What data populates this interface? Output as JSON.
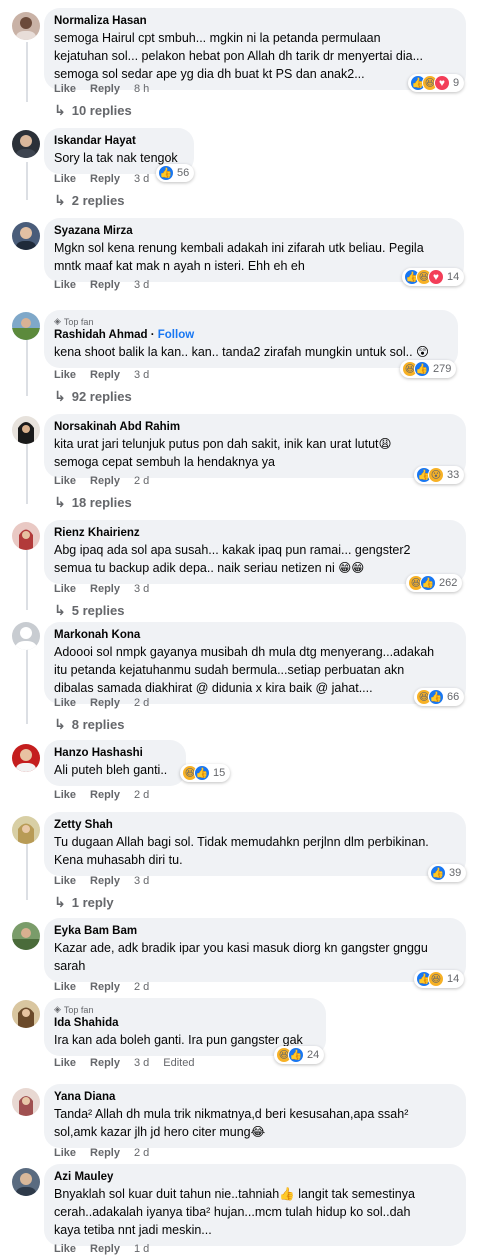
{
  "ui": {
    "like": "Like",
    "reply": "Reply",
    "edited": "Edited",
    "top_fan": "Top fan",
    "follow": "Follow"
  },
  "comments": [
    {
      "name": "Normaliza Hasan",
      "text": "semoga Hairul cpt smbuh... mgkin ni la petanda permulaan\nkejatuhan sol... pelakon hebat pon Allah dh tarik dr menyertai dia...\nsemoga sol sedar ape yg dia dh buat kt PS dan anak2...",
      "time": "8 h",
      "reactions": "9",
      "replies": "10 replies"
    },
    {
      "name": "Iskandar Hayat",
      "text": "Sory la tak nak tengok",
      "time": "3 d",
      "reactions": "56",
      "replies": "2 replies"
    },
    {
      "name": "Syazana Mirza",
      "text": "Mgkn sol kena renung kembali adakah ini zifarah utk beliau. Pegila\nmntk maaf kat mak n ayah n isteri. Ehh eh eh",
      "time": "3 d",
      "reactions": "14"
    },
    {
      "name": "Rashidah Ahmad",
      "text": "kena shoot balik la kan.. kan.. tanda2 zirafah mungkin untuk sol.. 😲",
      "time": "3 d",
      "reactions": "279",
      "replies": "92 replies"
    },
    {
      "name": "Norsakinah Abd Rahim",
      "text": "kita urat jari telunjuk putus pon dah sakit, inik kan urat lutut😩\nsemoga cepat sembuh la hendaknya ya",
      "time": "2 d",
      "reactions": "33",
      "replies": "18 replies"
    },
    {
      "name": "Rienz Khairienz",
      "text": "Abg ipaq ada sol apa susah... kakak ipaq pun ramai... gengster2\nsemua tu backup adik depa.. naik seriau netizen ni 😁😁",
      "time": "3 d",
      "reactions": "262",
      "replies": "5 replies"
    },
    {
      "name": "Markonah Kona",
      "text": "Adoooi sol nmpk gayanya musibah dh mula dtg menyerang...adakah\nitu petanda kejatuhanmu sudah bermula...setiap perbuatan akn\ndibalas samada diakhirat @ didunia x kira baik @ jahat....",
      "time": "2 d",
      "reactions": "66",
      "replies": "8 replies"
    },
    {
      "name": "Hanzo Hashashi",
      "text": "Ali puteh bleh ganti..",
      "time": "2 d",
      "reactions": "15"
    },
    {
      "name": "Zetty Shah",
      "text": "Tu dugaan Allah bagi sol. Tidak memudahkn perjlnn dlm perbikinan.\nKena muhasabh diri tu.",
      "time": "3 d",
      "reactions": "39",
      "replies": "1 reply"
    },
    {
      "name": "Eyka Bam Bam",
      "text": "Kazar ade, adk bradik ipar you kasi masuk diorg kn gangster gnggu\nsarah",
      "time": "2 d",
      "reactions": "14"
    },
    {
      "name": "Ida Shahida",
      "text": "Ira kan ada boleh ganti. Ira pun gangster gak",
      "time": "3 d",
      "reactions": "24"
    },
    {
      "name": "Yana Diana",
      "text": "Tanda² Allah dh mula trik nikmatnya,d beri kesusahan,apa ssah²\nsol,amk kazar jlh jd hero citer mung😂",
      "time": "2 d"
    },
    {
      "name": "Azi Mauley",
      "text": "Bnyaklah sol kuar duit tahun nie..tahniah👍 langit tak semestinya\ncerah..adakalah iyanya tiba² hujan...mcm tulah hidup ko sol..dah\nkaya tetiba nnt jadi meskin...",
      "time": "1 d"
    }
  ]
}
